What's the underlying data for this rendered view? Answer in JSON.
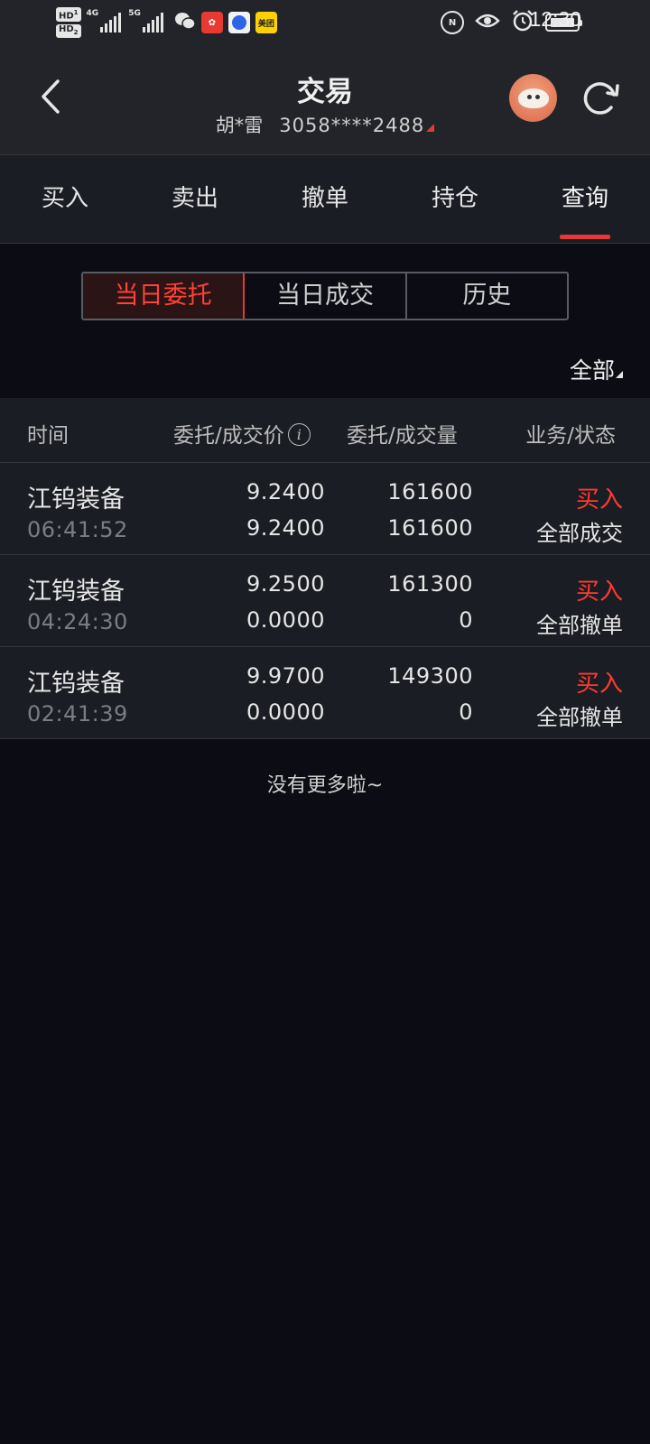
{
  "status_bar": {
    "sim1": "HD",
    "sim2": "HD",
    "sim1_index": "1",
    "sim2_index": "2",
    "net1": "4G",
    "net2": "5G",
    "meituan_label": "美团",
    "nfc_label": "N",
    "time": "12:30"
  },
  "header": {
    "title": "交易",
    "account_name": "胡*雷",
    "account_number": "3058****2488"
  },
  "tabs": [
    {
      "label": "买入"
    },
    {
      "label": "卖出"
    },
    {
      "label": "撤单"
    },
    {
      "label": "持仓"
    },
    {
      "label": "查询"
    }
  ],
  "segments": [
    {
      "label": "当日委托"
    },
    {
      "label": "当日成交"
    },
    {
      "label": "历史"
    }
  ],
  "filter": {
    "label": "全部"
  },
  "table": {
    "headers": {
      "time": "时间",
      "price": "委托/成交价",
      "info": "i",
      "qty": "委托/成交量",
      "status": "业务/状态"
    },
    "rows": [
      {
        "name": "江钨装备",
        "time": "06:41:52",
        "order_price": "9.2400",
        "deal_price": "9.2400",
        "order_qty": "161600",
        "deal_qty": "161600",
        "business": "买入",
        "status": "全部成交"
      },
      {
        "name": "江钨装备",
        "time": "04:24:30",
        "order_price": "9.2500",
        "deal_price": "0.0000",
        "order_qty": "161300",
        "deal_qty": "0",
        "business": "买入",
        "status": "全部撤单"
      },
      {
        "name": "江钨装备",
        "time": "02:41:39",
        "order_price": "9.9700",
        "deal_price": "0.0000",
        "order_qty": "149300",
        "deal_qty": "0",
        "business": "买入",
        "status": "全部撤单"
      }
    ]
  },
  "footer": {
    "no_more": "没有更多啦~"
  },
  "colors": {
    "accent_red": "#e53935",
    "background": "#0c0d14",
    "panel": "#1b1d24"
  }
}
